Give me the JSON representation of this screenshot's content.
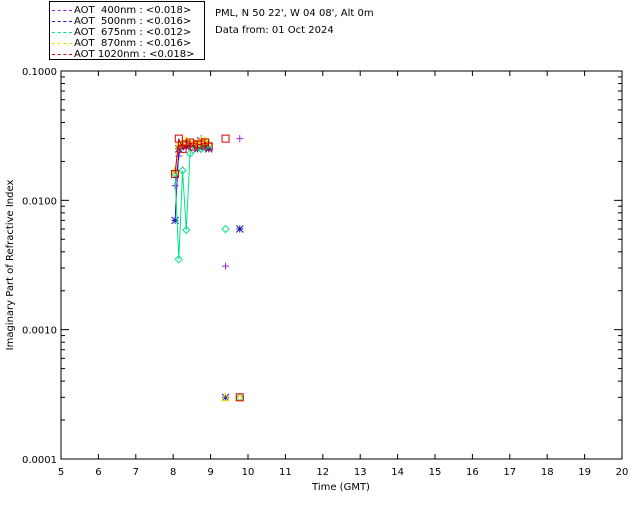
{
  "header": {
    "location": "PML, N 50 22', W 04 08', Alt 0m",
    "date_text": "Data from: 01 Oct 2024"
  },
  "legend": [
    {
      "label": "AOT  400nm : <0.018>",
      "color": "#a020f0"
    },
    {
      "label": "AOT  500nm : <0.016>",
      "color": "#1a1ab4"
    },
    {
      "label": "AOT  675nm : <0.012>",
      "color": "#00e28a"
    },
    {
      "label": "AOT  870nm : <0.016>",
      "color": "#f0e000"
    },
    {
      "label": "AOT 1020nm : <0.018>",
      "color": "#d40000"
    }
  ],
  "chart_data": {
    "type": "line",
    "xlabel": "Time (GMT)",
    "ylabel": "Imaginary Part of Refractive Index",
    "xlim": [
      5,
      20
    ],
    "ylim": [
      0.0001,
      0.1
    ],
    "y_scale": "log",
    "x_ticks": [
      "5",
      "6",
      "7",
      "8",
      "9",
      "10",
      "11",
      "12",
      "13",
      "14",
      "15",
      "16",
      "17",
      "18",
      "19",
      "20"
    ],
    "y_ticks": [
      "0.0001",
      "0.0010",
      "0.0100",
      "0.1000"
    ],
    "series": [
      {
        "name": "AOT  400nm : <0.018>",
        "color": "#a020f0",
        "marker": "plus",
        "x": [
          8.05,
          8.15,
          8.25,
          8.35,
          8.45,
          8.55,
          8.65,
          8.75,
          8.85,
          8.95,
          9.4,
          9.78
        ],
        "y": [
          0.013,
          0.022,
          0.028,
          0.029,
          0.028,
          0.028,
          0.029,
          0.03,
          0.029,
          0.028,
          0.0031,
          0.03
        ]
      },
      {
        "name": "AOT  500nm : <0.016>",
        "color": "#1a1ab4",
        "marker": "asterisk",
        "x": [
          8.05,
          8.15,
          8.25,
          8.35,
          8.45,
          8.55,
          8.65,
          8.75,
          8.85,
          8.95,
          9.4,
          9.78
        ],
        "y": [
          0.007,
          0.025,
          0.027,
          0.026,
          0.027,
          0.027,
          0.025,
          0.026,
          0.026,
          0.025,
          0.0003,
          0.006
        ]
      },
      {
        "name": "AOT  675nm : <0.012>",
        "color": "#00e28a",
        "marker": "diamond",
        "x": [
          8.05,
          8.15,
          8.25,
          8.35,
          8.45,
          8.55,
          8.65,
          8.75,
          8.85,
          8.95,
          9.4,
          9.78
        ],
        "y": [
          0.016,
          0.0035,
          0.017,
          0.0059,
          0.023,
          0.027,
          0.026,
          0.025,
          0.026,
          0.027,
          0.006,
          0.0003
        ]
      },
      {
        "name": "AOT  870nm : <0.016>",
        "color": "#f0e000",
        "marker": "triangle",
        "x": [
          8.05,
          8.15,
          8.25,
          8.35,
          8.45,
          8.55,
          8.65,
          8.75,
          8.85,
          8.95,
          9.4,
          9.78
        ],
        "y": [
          0.017,
          0.027,
          0.028,
          0.029,
          0.028,
          0.028,
          0.028,
          0.029,
          0.029,
          0.028,
          0.0003,
          0.0003
        ]
      },
      {
        "name": "AOT 1020nm : <0.018>",
        "color": "#d40000",
        "marker": "square",
        "x": [
          8.05,
          8.15,
          8.25,
          8.35,
          8.45,
          8.55,
          8.65,
          8.75,
          8.85,
          8.95,
          9.4,
          9.78
        ],
        "y": [
          0.016,
          0.03,
          0.025,
          0.027,
          0.028,
          0.026,
          0.027,
          0.027,
          0.028,
          0.026,
          0.03,
          0.0003
        ]
      }
    ]
  }
}
